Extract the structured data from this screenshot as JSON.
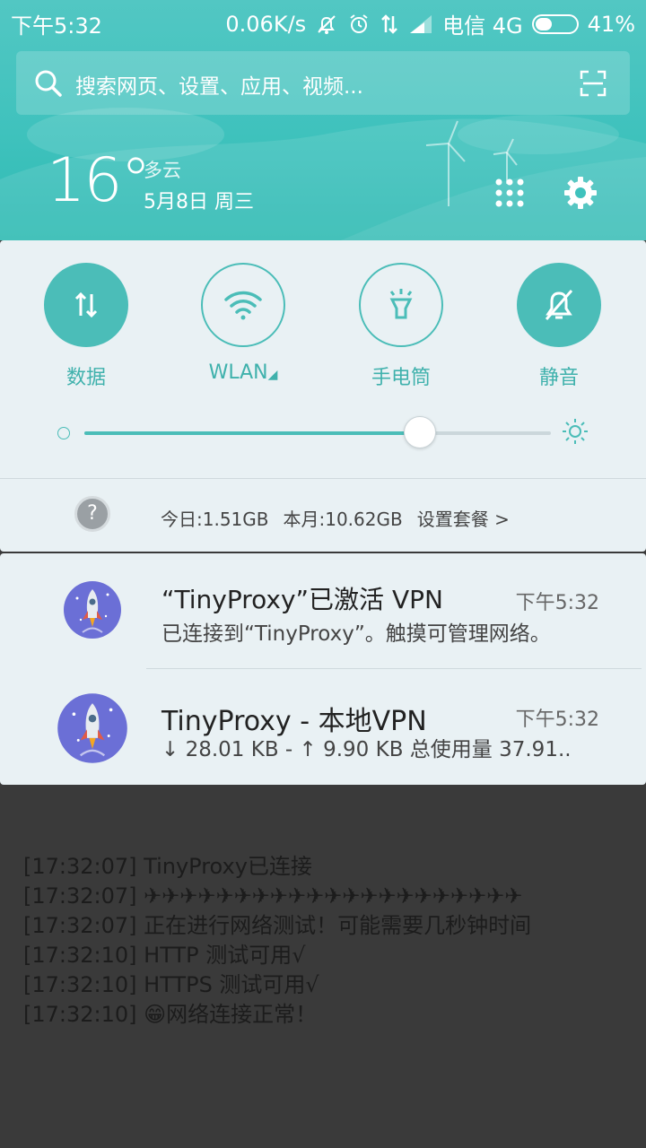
{
  "status_bar": {
    "time": "下午5:32",
    "net_speed": "0.06K/s",
    "carrier": "电信 4G",
    "battery": "41%",
    "battery_level": 0.41
  },
  "search": {
    "placeholder": "搜索网页、设置、应用、视频..."
  },
  "weather": {
    "temperature": "16°",
    "condition": "多云",
    "date": "5月8日 周三"
  },
  "quick_settings": [
    {
      "label": "数据",
      "icon": "data-arrows-icon",
      "active": true
    },
    {
      "label": "WLAN",
      "icon": "wifi-icon",
      "active": false
    },
    {
      "label": "手电筒",
      "icon": "flashlight-icon",
      "active": false
    },
    {
      "label": "静音",
      "icon": "bell-off-icon",
      "active": true
    }
  ],
  "brightness": {
    "level": 0.72
  },
  "data_usage": {
    "today": "今日:1.51GB",
    "month": "本月:10.62GB",
    "plan_link": "设置套餐 >"
  },
  "notifications": [
    {
      "title": "“TinyProxy”已激活 VPN",
      "time": "下午5:32",
      "body": "已连接到“TinyProxy”。触摸可管理网络。"
    },
    {
      "title": "TinyProxy - 本地VPN",
      "time": "下午5:32",
      "body": "↓ 28.01 KB - ↑ 9.90 KB 总使用量 37.91.."
    }
  ],
  "log_lines": [
    "[17:32:07] TinyProxy已连接",
    "[17:32:07] ✈✈✈✈✈✈✈✈✈✈✈✈✈✈✈✈✈✈✈✈✈",
    "[17:32:07] 正在进行网络测试！可能需要几秒钟时间",
    "[17:32:10] HTTP 测试可用√",
    "[17:32:10] HTTPS 测试可用√",
    "[17:32:10] 😁网络连接正常！"
  ],
  "colors": {
    "accent": "#4bbdb8",
    "header": "#3fc2bd",
    "panel": "#e9f1f4"
  }
}
